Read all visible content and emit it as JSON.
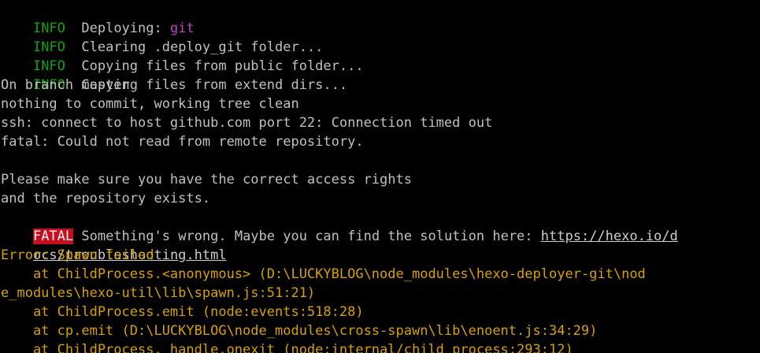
{
  "colors": {
    "background": "#000000",
    "default_text": "#c0c0c0",
    "info_tag": "#13a10e",
    "highlight_word": "#c040c0",
    "fatal_bg": "#c50f1f",
    "error_text": "#d7a100"
  },
  "log": {
    "info_tag": "INFO",
    "line1_text": "  Deploying: ",
    "line1_highlight": "git",
    "line2_text": "  Clearing .deploy_git folder...",
    "line3_text": "  Copying files from public folder...",
    "line4_text": "  Copying files from extend dirs...",
    "line5": "On branch master",
    "line6": "nothing to commit, working tree clean",
    "line7": "ssh: connect to host github.com port 22: Connection timed out",
    "line8": "fatal: Could not read from remote repository.",
    "line10": "Please make sure you have the correct access rights",
    "line11": "and the repository exists.",
    "fatal_tag": "FATAL",
    "fatal_text": " Something's wrong. Maybe you can find the solution here: ",
    "fatal_link_part1": "https://hexo.io/d",
    "fatal_link_part2": "ocs/troubleshooting.html",
    "error_line": "Error: Spawn failed",
    "stack1": "    at ChildProcess.<anonymous> (D:\\LUCKYBLOG\\node_modules\\hexo-deployer-git\\nod",
    "stack1_cont": "e_modules\\hexo-util\\lib\\spawn.js:51:21)",
    "stack2": "    at ChildProcess.emit (node:events:518:28)",
    "stack3": "    at cp.emit (D:\\LUCKYBLOG\\node_modules\\cross-spawn\\lib\\enoent.js:34:29)",
    "stack4": "    at ChildProcess._handle.onexit (node:internal/child_process:293:12)"
  }
}
